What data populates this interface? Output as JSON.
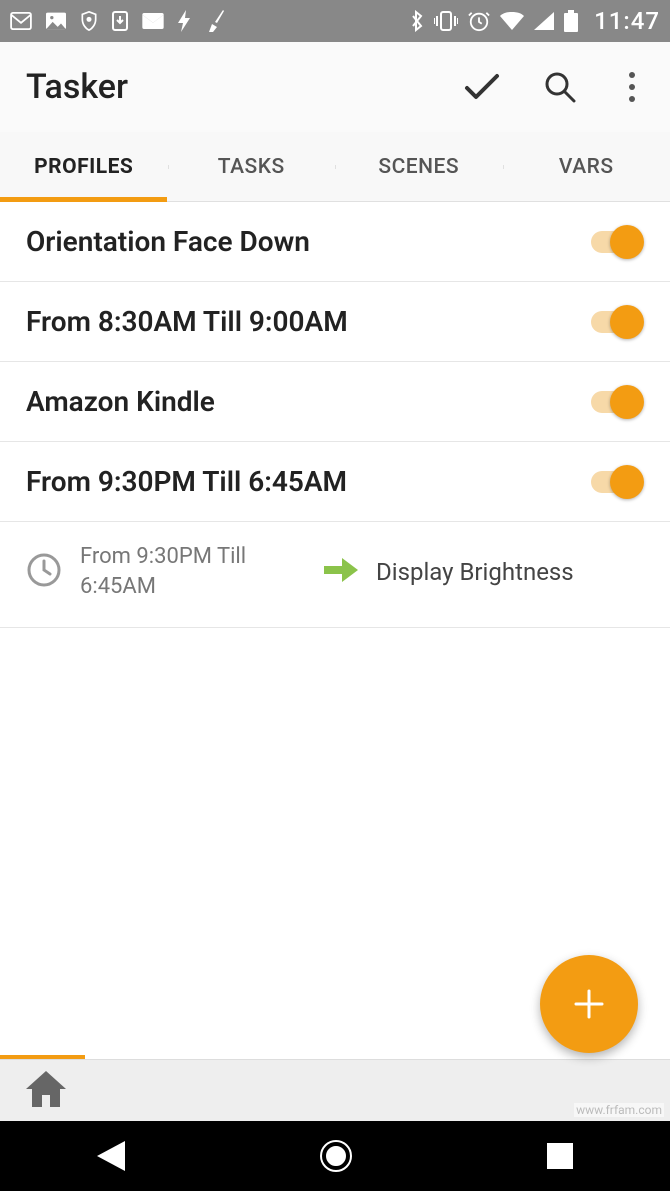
{
  "status": {
    "time": "11:47"
  },
  "app": {
    "title": "Tasker"
  },
  "tabs": {
    "items": [
      "PROFILES",
      "TASKS",
      "SCENES",
      "VARS"
    ],
    "active_index": 0
  },
  "profiles": [
    {
      "title": "Orientation Face Down",
      "enabled": true
    },
    {
      "title": "From  8:30AM Till  9:00AM",
      "enabled": true
    },
    {
      "title": "Amazon Kindle",
      "enabled": true
    },
    {
      "title": "From  9:30PM Till  6:45AM",
      "enabled": true
    }
  ],
  "expanded": {
    "condition": "From  9:30PM Till 6:45AM",
    "task": "Display Brightness"
  },
  "colors": {
    "accent": "#f39c12",
    "task_arrow": "#8bc34a"
  },
  "watermark": "www.frfam.com"
}
